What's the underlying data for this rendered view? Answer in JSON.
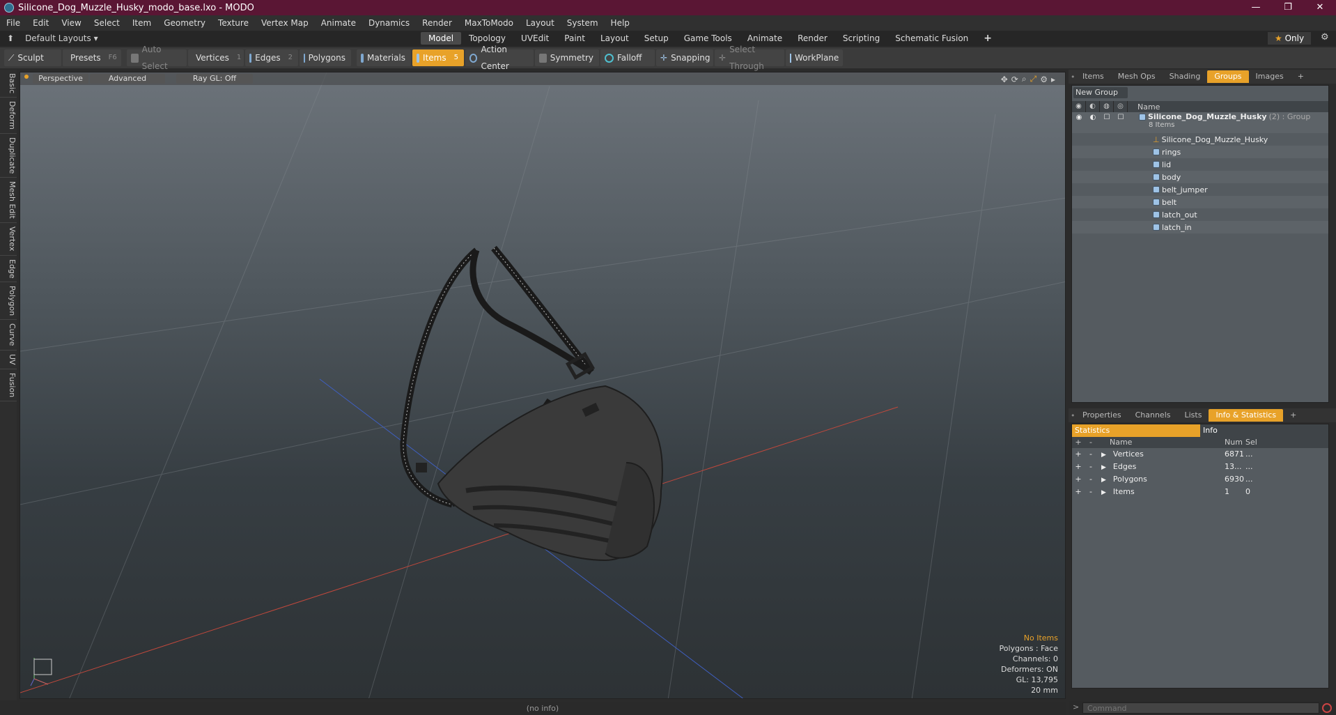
{
  "window": {
    "title": "Silicone_Dog_Muzzle_Husky_modo_base.lxo - MODO",
    "minimize": "—",
    "maximize": "❐",
    "close": "✕"
  },
  "menu": [
    "File",
    "Edit",
    "View",
    "Select",
    "Item",
    "Geometry",
    "Texture",
    "Vertex Map",
    "Animate",
    "Dynamics",
    "Render",
    "MaxToModo",
    "Layout",
    "System",
    "Help"
  ],
  "layoutbar": {
    "layouts_label": "Default Layouts",
    "tabs": [
      "Model",
      "Topology",
      "UVEdit",
      "Paint",
      "Layout",
      "Setup",
      "Game Tools",
      "Animate",
      "Render",
      "Scripting",
      "Schematic Fusion"
    ],
    "active_tab": "Model",
    "add": "+",
    "only_label": "Only"
  },
  "toolbar": {
    "sculpt": "Sculpt",
    "presets": "Presets",
    "presets_key": "F6",
    "auto_select": "Auto Select",
    "vertices": "Vertices",
    "vertices_key": "1",
    "edges": "Edges",
    "edges_key": "2",
    "polygons": "Polygons",
    "materials": "Materials",
    "items": "Items",
    "items_key": "5",
    "action_center": "Action Center",
    "symmetry": "Symmetry",
    "falloff": "Falloff",
    "snapping": "Snapping",
    "select_through": "Select Through",
    "workplane": "WorkPlane"
  },
  "left_tabs": [
    "Basic",
    "Deform",
    "Duplicate",
    "Mesh Edit",
    "Vertex",
    "Edge",
    "Polygon",
    "Curve",
    "UV",
    "Fusion"
  ],
  "viewport": {
    "perspective": "Perspective",
    "advanced": "Advanced",
    "raygl": "Ray GL: Off",
    "stats": {
      "no_items": "No Items",
      "polygons": "Polygons : Face",
      "channels": "Channels: 0",
      "deformers": "Deformers: ON",
      "gl": "GL: 13,795",
      "size": "20 mm"
    }
  },
  "status": "(no info)",
  "groups_panel": {
    "tabs": [
      "Items",
      "Mesh Ops",
      "Shading",
      "Groups",
      "Images"
    ],
    "active_tab": "Groups",
    "new_group": "New Group",
    "col_name": "Name",
    "group": {
      "name": "Silicone_Dog_Muzzle_Husky",
      "suffix": "(2) : Group",
      "count": "8 Items"
    },
    "children": [
      "Silicone_Dog_Muzzle_Husky",
      "rings",
      "lid",
      "body",
      "belt_jumper",
      "belt",
      "latch_out",
      "latch_in"
    ]
  },
  "info_panel": {
    "tabs": [
      "Properties",
      "Channels",
      "Lists",
      "Info & Statistics"
    ],
    "active_tab": "Info & Statistics",
    "sub_statistics": "Statistics",
    "sub_info": "Info",
    "col_name": "Name",
    "col_num": "Num",
    "col_sel": "Sel",
    "rows": [
      {
        "name": "Vertices",
        "num": "6871",
        "sel": "..."
      },
      {
        "name": "Edges",
        "num": "13...",
        "sel": "..."
      },
      {
        "name": "Polygons",
        "num": "6930",
        "sel": "..."
      },
      {
        "name": "Items",
        "num": "1",
        "sel": "0"
      }
    ]
  },
  "command": {
    "placeholder": "Command"
  },
  "colors": {
    "accent": "#e8a229",
    "titlebar": "#5a1634"
  }
}
